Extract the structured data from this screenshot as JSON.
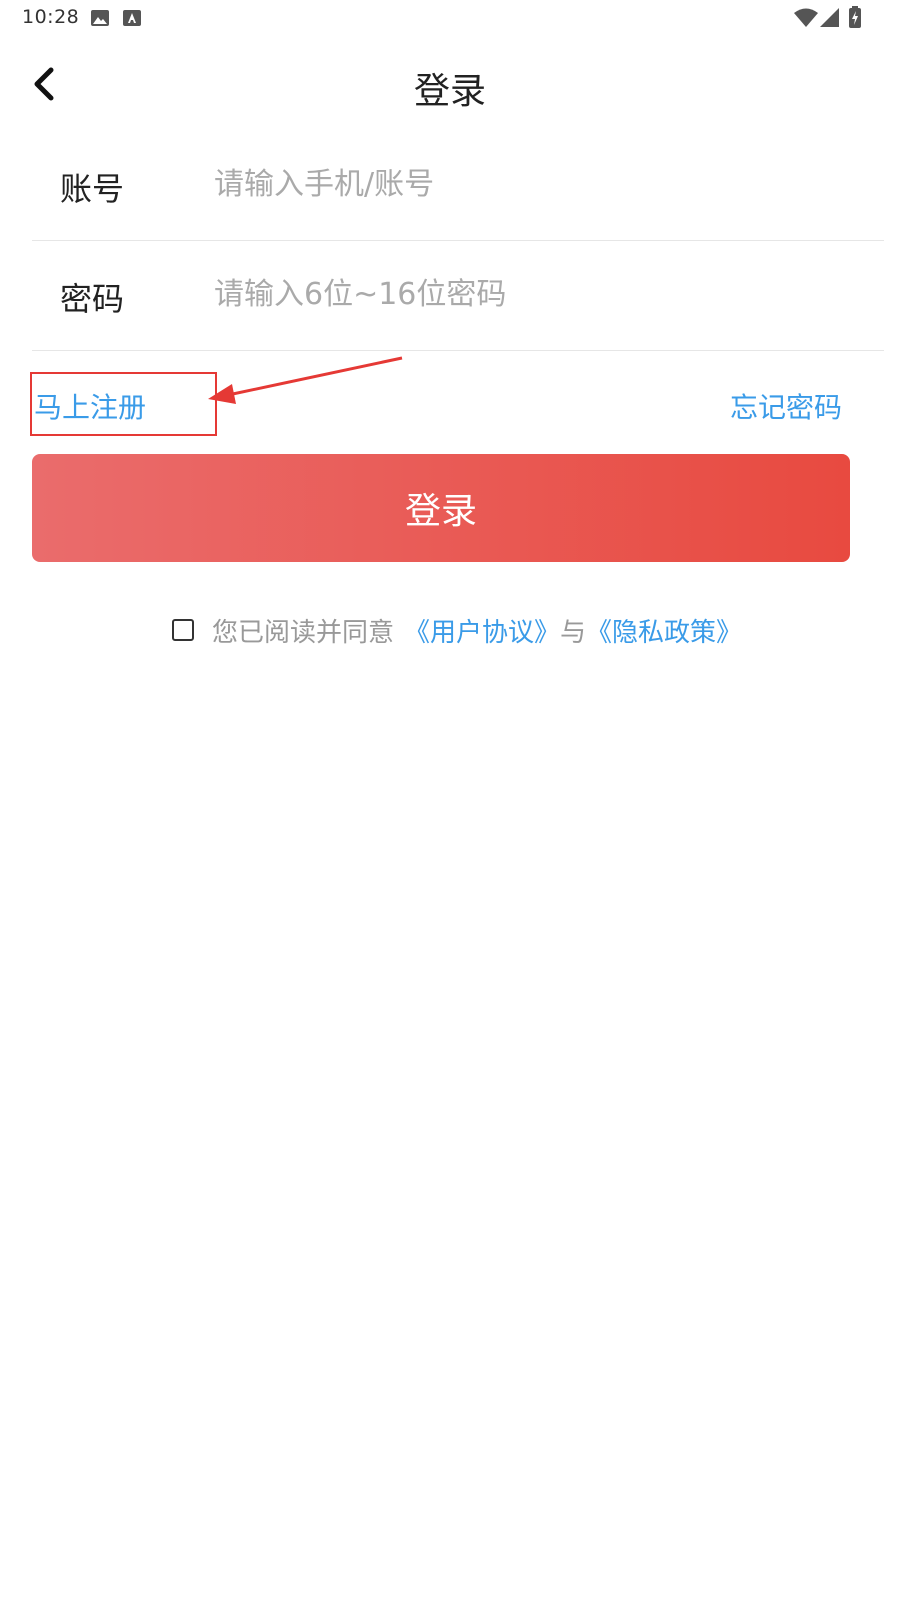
{
  "status_bar": {
    "time": "10:28"
  },
  "header": {
    "title": "登录",
    "back_icon": "chevron-left-icon"
  },
  "form": {
    "account": {
      "label": "账号",
      "placeholder": "请输入手机/账号",
      "value": ""
    },
    "password": {
      "label": "密码",
      "placeholder": "请输入6位~16位密码",
      "value": ""
    }
  },
  "links": {
    "register": "马上注册",
    "forgot_password": "忘记密码"
  },
  "login_button": {
    "label": "登录"
  },
  "agreement": {
    "checked": false,
    "prefix": "您已阅读并同意",
    "user_agreement": "《用户协议》",
    "conjunction": "与",
    "privacy_policy": "《隐私政策》"
  },
  "colors": {
    "link": "#3a9be8",
    "button_start": "#ea6c6c",
    "button_end": "#e84a40",
    "annotation": "#e53935"
  }
}
